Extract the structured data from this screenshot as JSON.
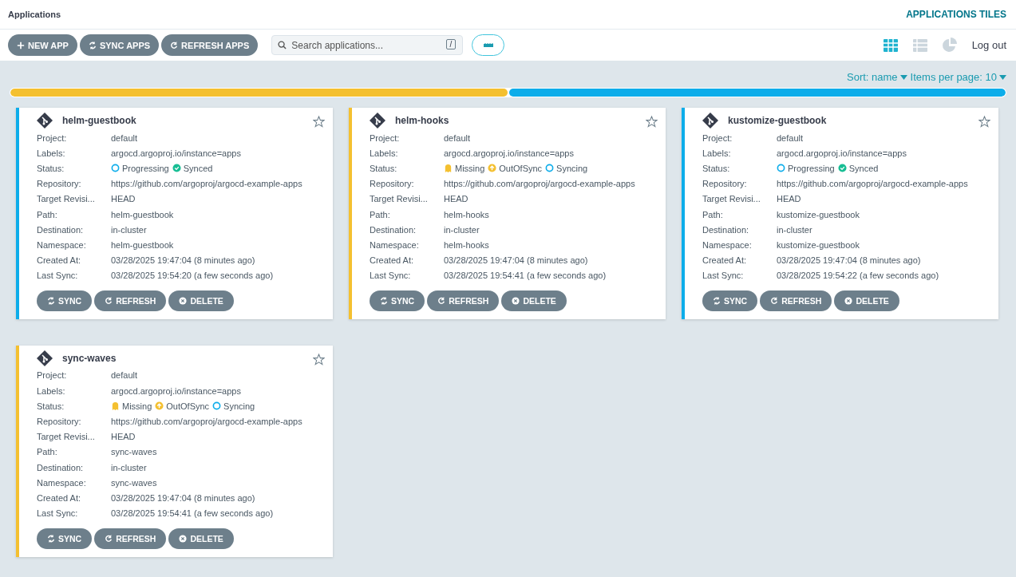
{
  "header": {
    "title": "Applications",
    "view_title": "APPLICATIONS TILES"
  },
  "toolbar": {
    "buttons": [
      {
        "kind": "plus",
        "label": "NEW APP"
      },
      {
        "kind": "sync",
        "label": "SYNC APPS"
      },
      {
        "kind": "refresh",
        "label": "REFRESH APPS"
      }
    ],
    "search": {
      "placeholder": "Search applications...",
      "shortcut": "/"
    },
    "views": [
      {
        "kind": "tiles",
        "selected": true
      },
      {
        "kind": "list",
        "selected": false
      },
      {
        "kind": "summary",
        "selected": false
      }
    ],
    "logout": "Log out"
  },
  "sort": {
    "sort": "Sort: name",
    "per_page": "Items per page: 10"
  },
  "status_bar": [
    {
      "color": "#f4c030",
      "level": 0.5
    },
    {
      "color": "#0dadea",
      "level": 0.5
    }
  ],
  "apps": [
    {
      "name": "helm-guestbook",
      "color": "#0dadea",
      "fields": [
        {
          "label": "Project:",
          "value": "default"
        },
        {
          "label": "Labels:",
          "value": "argocd.argoproj.io/instance=apps"
        },
        {
          "label": "Status:",
          "status": [
            {
              "kind": "progressing",
              "label": "Progressing"
            },
            {
              "kind": "synced",
              "label": "Synced"
            }
          ]
        },
        {
          "label": "Repository:",
          "value": "https://github.com/argoproj/argocd-example-apps"
        },
        {
          "label": "Target Revisi...",
          "value": "HEAD"
        },
        {
          "label": "Path:",
          "value": "helm-guestbook"
        },
        {
          "label": "Destination:",
          "value": "in-cluster"
        },
        {
          "label": "Namespace:",
          "value": "helm-guestbook"
        },
        {
          "label": "Created At:",
          "value": "03/28/2025 19:47:04  (8 minutes ago)"
        },
        {
          "label": "Last Sync:",
          "value": "03/28/2025 19:54:20  (a few seconds ago)"
        }
      ],
      "actions": [
        {
          "kind": "sync",
          "label": "SYNC"
        },
        {
          "kind": "refresh",
          "label": "REFRESH"
        },
        {
          "kind": "delete",
          "label": "DELETE"
        }
      ]
    },
    {
      "name": "helm-hooks",
      "color": "#f4c030",
      "fields": [
        {
          "label": "Project:",
          "value": "default"
        },
        {
          "label": "Labels:",
          "value": "argocd.argoproj.io/instance=apps"
        },
        {
          "label": "Status:",
          "status": [
            {
              "kind": "missing",
              "label": "Missing"
            },
            {
              "kind": "outofsync",
              "label": "OutOfSync"
            },
            {
              "kind": "syncing",
              "label": "Syncing"
            }
          ]
        },
        {
          "label": "Repository:",
          "value": "https://github.com/argoproj/argocd-example-apps"
        },
        {
          "label": "Target Revisi...",
          "value": "HEAD"
        },
        {
          "label": "Path:",
          "value": "helm-hooks"
        },
        {
          "label": "Destination:",
          "value": "in-cluster"
        },
        {
          "label": "Namespace:",
          "value": "helm-hooks"
        },
        {
          "label": "Created At:",
          "value": "03/28/2025 19:47:04  (8 minutes ago)"
        },
        {
          "label": "Last Sync:",
          "value": "03/28/2025 19:54:41  (a few seconds ago)"
        }
      ],
      "actions": [
        {
          "kind": "sync",
          "label": "SYNC"
        },
        {
          "kind": "refresh",
          "label": "REFRESH"
        },
        {
          "kind": "delete",
          "label": "DELETE"
        }
      ]
    },
    {
      "name": "kustomize-guestbook",
      "color": "#0dadea",
      "fields": [
        {
          "label": "Project:",
          "value": "default"
        },
        {
          "label": "Labels:",
          "value": "argocd.argoproj.io/instance=apps"
        },
        {
          "label": "Status:",
          "status": [
            {
              "kind": "progressing",
              "label": "Progressing"
            },
            {
              "kind": "synced",
              "label": "Synced"
            }
          ]
        },
        {
          "label": "Repository:",
          "value": "https://github.com/argoproj/argocd-example-apps"
        },
        {
          "label": "Target Revisi...",
          "value": "HEAD"
        },
        {
          "label": "Path:",
          "value": "kustomize-guestbook"
        },
        {
          "label": "Destination:",
          "value": "in-cluster"
        },
        {
          "label": "Namespace:",
          "value": "kustomize-guestbook"
        },
        {
          "label": "Created At:",
          "value": "03/28/2025 19:47:04  (8 minutes ago)"
        },
        {
          "label": "Last Sync:",
          "value": "03/28/2025 19:54:22  (a few seconds ago)"
        }
      ],
      "actions": [
        {
          "kind": "sync",
          "label": "SYNC"
        },
        {
          "kind": "refresh",
          "label": "REFRESH"
        },
        {
          "kind": "delete",
          "label": "DELETE"
        }
      ]
    },
    {
      "name": "sync-waves",
      "color": "#f4c030",
      "fields": [
        {
          "label": "Project:",
          "value": "default"
        },
        {
          "label": "Labels:",
          "value": "argocd.argoproj.io/instance=apps"
        },
        {
          "label": "Status:",
          "status": [
            {
              "kind": "missing",
              "label": "Missing"
            },
            {
              "kind": "outofsync",
              "label": "OutOfSync"
            },
            {
              "kind": "syncing",
              "label": "Syncing"
            }
          ]
        },
        {
          "label": "Repository:",
          "value": "https://github.com/argoproj/argocd-example-apps"
        },
        {
          "label": "Target Revisi...",
          "value": "HEAD"
        },
        {
          "label": "Path:",
          "value": "sync-waves"
        },
        {
          "label": "Destination:",
          "value": "in-cluster"
        },
        {
          "label": "Namespace:",
          "value": "sync-waves"
        },
        {
          "label": "Created At:",
          "value": "03/28/2025 19:47:04  (8 minutes ago)"
        },
        {
          "label": "Last Sync:",
          "value": "03/28/2025 19:54:41  (a few seconds ago)"
        }
      ],
      "actions": [
        {
          "kind": "sync",
          "label": "SYNC"
        },
        {
          "kind": "refresh",
          "label": "REFRESH"
        },
        {
          "kind": "delete",
          "label": "DELETE"
        }
      ]
    }
  ]
}
